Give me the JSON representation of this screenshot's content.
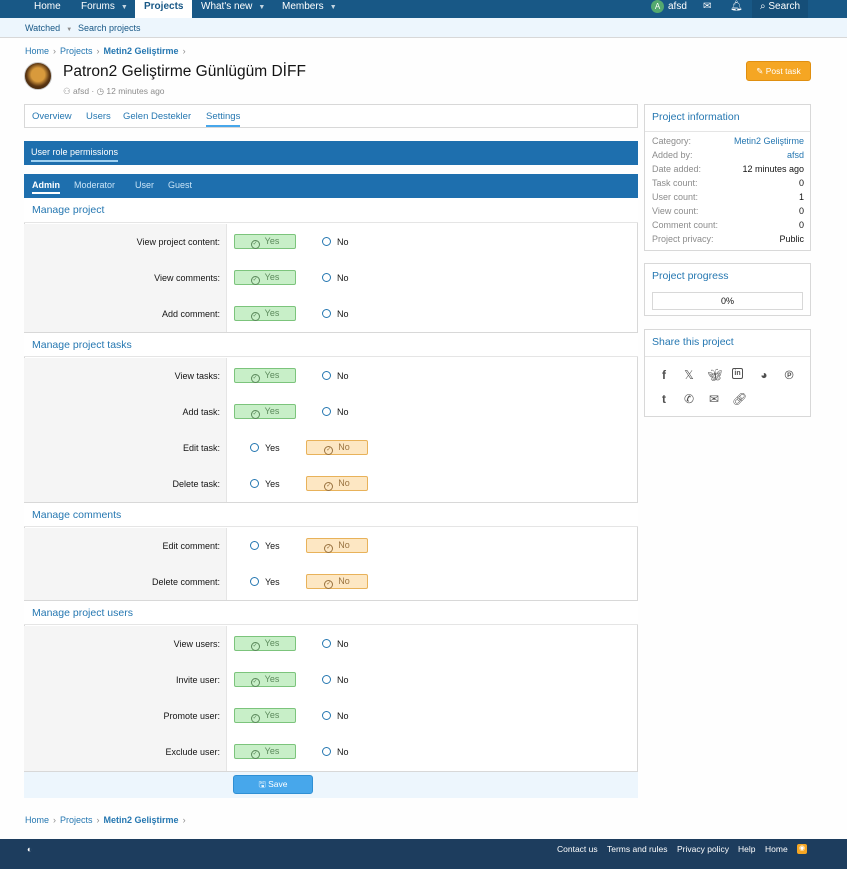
{
  "nav": {
    "items": [
      "Home",
      "Forums",
      "Projects",
      "What's new",
      "Members"
    ],
    "user": "afsd",
    "user_initial": "A",
    "search": "Search"
  },
  "subnav": {
    "items": [
      "Watched",
      "Search projects"
    ]
  },
  "breadcrumb": [
    "Home",
    "Projects",
    "Metin2 Geliştirme"
  ],
  "project": {
    "title": "Patron2 Geliştirme Günlügüm DİFF",
    "author": "afsd",
    "time": "12 minutes ago",
    "post_task": "Post task"
  },
  "tabs": [
    "Overview",
    "Users",
    "Gelen Destekler",
    "Settings"
  ],
  "block_title": "User role permissions",
  "roles": [
    "Admin",
    "Moderator",
    "User",
    "Guest"
  ],
  "sections": [
    {
      "title": "Manage project",
      "rows": [
        {
          "label": "View project content:",
          "value": "Yes"
        },
        {
          "label": "View comments:",
          "value": "Yes"
        },
        {
          "label": "Add comment:",
          "value": "Yes"
        }
      ]
    },
    {
      "title": "Manage project tasks",
      "rows": [
        {
          "label": "View tasks:",
          "value": "Yes"
        },
        {
          "label": "Add task:",
          "value": "Yes"
        },
        {
          "label": "Edit task:",
          "value": "No"
        },
        {
          "label": "Delete task:",
          "value": "No"
        }
      ]
    },
    {
      "title": "Manage comments",
      "rows": [
        {
          "label": "Edit comment:",
          "value": "No"
        },
        {
          "label": "Delete comment:",
          "value": "No"
        }
      ]
    },
    {
      "title": "Manage project users",
      "rows": [
        {
          "label": "View users:",
          "value": "Yes"
        },
        {
          "label": "Invite user:",
          "value": "Yes"
        },
        {
          "label": "Promote user:",
          "value": "Yes"
        },
        {
          "label": "Exclude user:",
          "value": "Yes"
        }
      ]
    }
  ],
  "option_labels": {
    "yes": "Yes",
    "no": "No"
  },
  "save": "Save",
  "sidebar": {
    "info_title": "Project information",
    "info": [
      {
        "k": "Category:",
        "v": "Metin2 Geliştirme",
        "link": true
      },
      {
        "k": "Added by:",
        "v": "afsd",
        "link": true
      },
      {
        "k": "Date added:",
        "v": "12 minutes ago",
        "link": false
      },
      {
        "k": "Task count:",
        "v": "0",
        "link": false
      },
      {
        "k": "User count:",
        "v": "1",
        "link": false
      },
      {
        "k": "View count:",
        "v": "0",
        "link": false
      },
      {
        "k": "Comment count:",
        "v": "0",
        "link": false
      },
      {
        "k": "Project privacy:",
        "v": "Public",
        "link": false
      }
    ],
    "progress_title": "Project progress",
    "progress": "0%",
    "share_title": "Share this project",
    "share_icons": [
      "facebook-icon",
      "x-icon",
      "bluesky-icon",
      "linkedin-icon",
      "reddit-icon",
      "pinterest-icon",
      "tumblr-icon",
      "whatsapp-icon",
      "email-icon",
      "link-icon"
    ]
  },
  "footer": {
    "links": [
      "Contact us",
      "Terms and rules",
      "Privacy policy",
      "Help",
      "Home"
    ]
  },
  "colors": {
    "nav": "#185886",
    "accent": "#2577b1",
    "block": "#1e6fae",
    "yes": "#c8efc8",
    "no": "#fde7c3",
    "post": "#f5a623",
    "footer": "#1d3d5e"
  }
}
